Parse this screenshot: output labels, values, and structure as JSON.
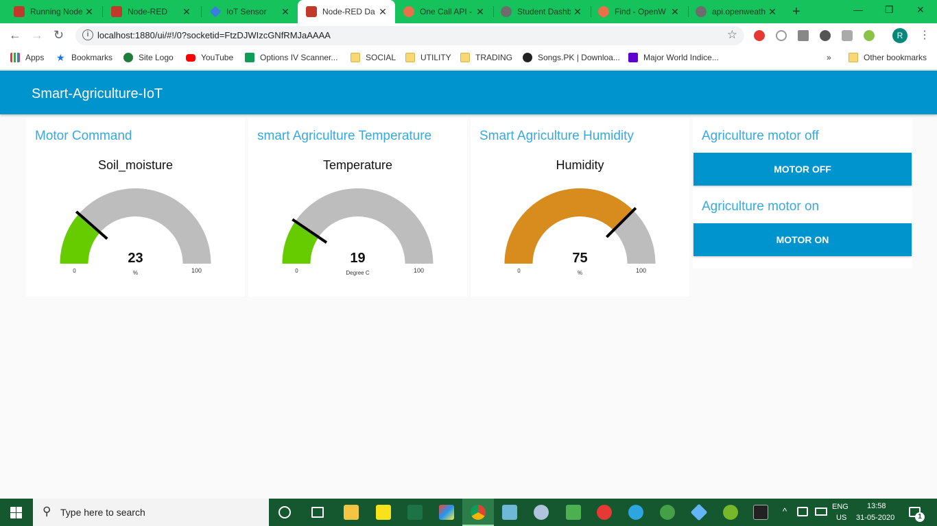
{
  "browser": {
    "tabs": [
      {
        "title": "Running Node",
        "favicon_color": "#c0392b"
      },
      {
        "title": "Node-RED",
        "favicon_color": "#c0392b"
      },
      {
        "title": "IoT Sensor",
        "favicon_color": "#3b7ddd"
      },
      {
        "title": "Node-RED Da",
        "favicon_color": "#c0392b",
        "active": true
      },
      {
        "title": "One Call API -",
        "favicon_color": "#e8704a"
      },
      {
        "title": "Student Dashb",
        "favicon_color": "#6d6d6d"
      },
      {
        "title": "Find - OpenW",
        "favicon_color": "#e8704a"
      },
      {
        "title": "api.openweath",
        "favicon_color": "#6d6d6d"
      }
    ],
    "new_tab": "+",
    "window_controls": {
      "minimize": "—",
      "restore": "❐",
      "close": "✕"
    },
    "url": "localhost:1880/ui/#!/0?socketid=FtzDJWIzcGNfRMJaAAAA",
    "profile_initial": "R",
    "bookmarks": [
      "Apps",
      "Bookmarks",
      "Site Logo",
      "YouTube",
      "Options IV Scanner...",
      "SOCIAL",
      "UTILITY",
      "TRADING",
      "Songs.PK | Downloa...",
      "Major World Indice..."
    ],
    "bookmarks_more": "»",
    "other_bookmarks": "Other bookmarks"
  },
  "dashboard": {
    "title": "Smart-Agriculture-IoT",
    "cards": [
      {
        "title": "Motor Command",
        "label": "Soil_moisture",
        "value": 23,
        "min": 0,
        "max": 100,
        "unit": "%",
        "color": "#66cc00"
      },
      {
        "title": "smart Agriculture Temperature",
        "label": "Temperature",
        "value": 19,
        "min": 0,
        "max": 100,
        "unit": "Degree C",
        "color": "#66cc00"
      },
      {
        "title": "Smart Agriculture Humidity",
        "label": "Humidity",
        "value": 75,
        "min": 0,
        "max": 100,
        "unit": "%",
        "color": "#d88c1e"
      }
    ],
    "controls": [
      {
        "title": "Agriculture motor off",
        "button": "MOTOR OFF"
      },
      {
        "title": "Agriculture motor on",
        "button": "MOTOR ON"
      }
    ],
    "gauge_track_color": "#bdbdbd",
    "accent": "#0094ce"
  },
  "taskbar": {
    "search_placeholder": "Type here to search",
    "lang": "ENG",
    "region": "US",
    "time": "13:58",
    "date": "31-05-2020",
    "notification_count": "1"
  }
}
